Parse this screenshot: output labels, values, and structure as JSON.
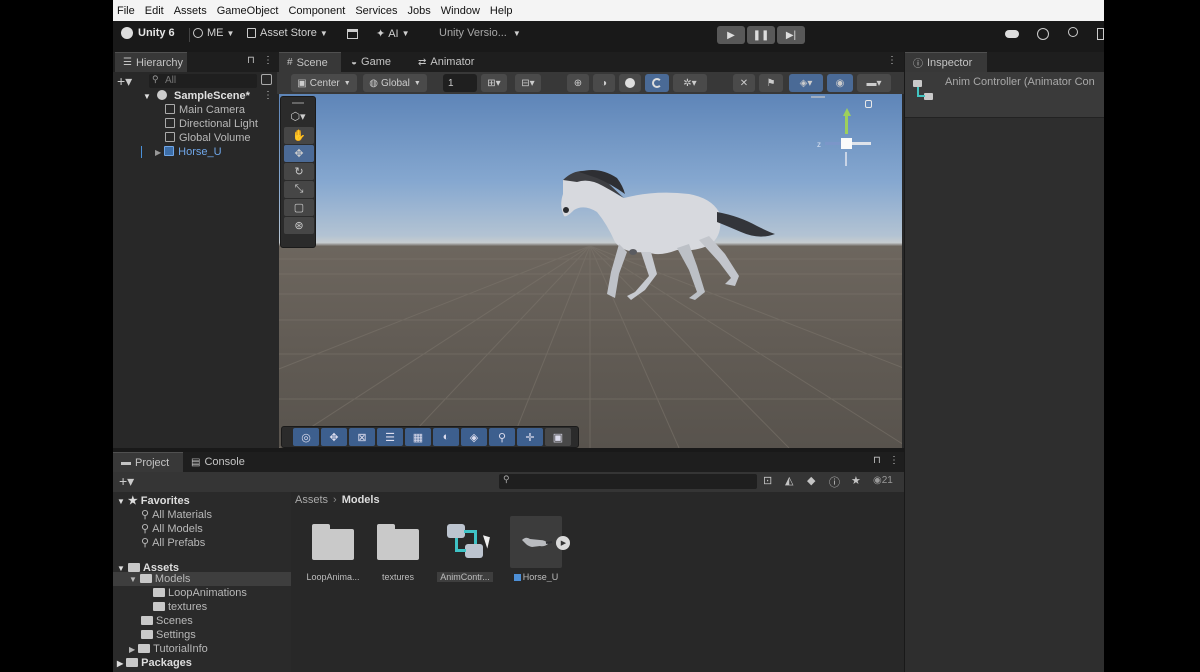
{
  "menu": [
    "File",
    "Edit",
    "Assets",
    "GameObject",
    "Component",
    "Services",
    "Jobs",
    "Window",
    "Help"
  ],
  "toolbar": {
    "unity_label": "Unity 6",
    "account_label": "ME",
    "asset_store_label": "Asset Store",
    "ai_label": "AI",
    "version_label": "Unity Versio..."
  },
  "hierarchy": {
    "tab_label": "Hierarchy",
    "search_placeholder": "All",
    "scene_name": "SampleScene*",
    "items": [
      "Main Camera",
      "Directional Light",
      "Global Volume",
      "Horse_U"
    ]
  },
  "scene_tabs": [
    "Scene",
    "Game",
    "Animator"
  ],
  "scene_toolbar": {
    "pivot_label": "Center",
    "space_label": "Global",
    "grid_value": "1"
  },
  "inspector": {
    "tab_label": "Inspector",
    "object_label": "Anim Controller (Animator Con"
  },
  "project": {
    "tabs": [
      "Project",
      "Console"
    ],
    "breadcrumb": [
      "Assets",
      "Models"
    ],
    "count": "21",
    "favorites_label": "Favorites",
    "favorites": [
      "All Materials",
      "All Models",
      "All Prefabs"
    ],
    "assets_label": "Assets",
    "tree": [
      "Models",
      "LoopAnimations",
      "textures",
      "Scenes",
      "Settings",
      "TutorialInfo"
    ],
    "packages_label": "Packages",
    "grid": [
      "LoopAnima...",
      "textures",
      "AnimContr...",
      "Horse_U"
    ]
  },
  "colors": {
    "accent": "#4b6a96",
    "selection": "#2c5d87",
    "bg": "#282828"
  }
}
